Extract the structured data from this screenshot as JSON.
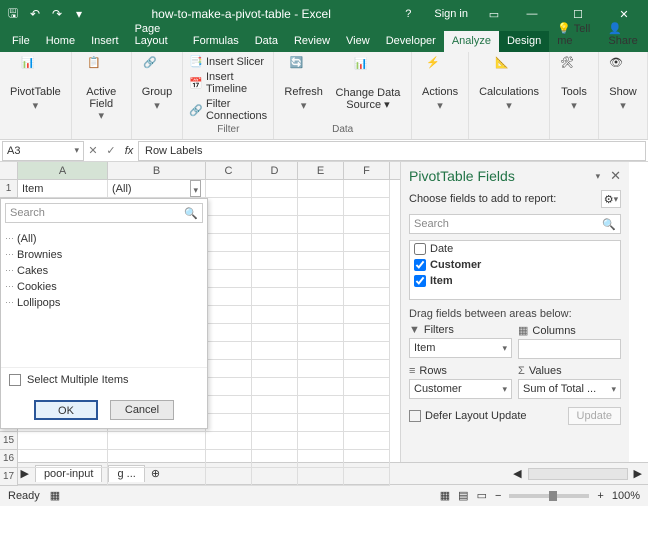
{
  "title": "how-to-make-a-pivot-table - Excel",
  "qat_icons": [
    "save-icon",
    "undo-icon",
    "redo-icon",
    "qat-more-icon"
  ],
  "signin": "Sign in",
  "tabs": [
    "File",
    "Home",
    "Insert",
    "Page Layout",
    "Formulas",
    "Data",
    "Review",
    "View",
    "Developer"
  ],
  "context_tabs": {
    "analyze": "Analyze",
    "design": "Design"
  },
  "tellme": "Tell me",
  "share": "Share",
  "ribbon": {
    "pivottable": "PivotTable",
    "activefield": "Active Field",
    "group": "Group",
    "insert_slicer": "Insert Slicer",
    "insert_timeline": "Insert Timeline",
    "filter_connections": "Filter Connections",
    "filter_group": "Filter",
    "refresh": "Refresh",
    "change_data": "Change Data Source",
    "data_group": "Data",
    "actions": "Actions",
    "calculations": "Calculations",
    "tools": "Tools",
    "show": "Show"
  },
  "namebox": "A3",
  "formula": "Row Labels",
  "columns": [
    "A",
    "B",
    "C",
    "D",
    "E",
    "F"
  ],
  "row1": {
    "a": "Item",
    "b": "(All)"
  },
  "filter_dropdown": {
    "search_placeholder": "Search",
    "items": [
      "(All)",
      "Brownies",
      "Cakes",
      "Cookies",
      "Lollipops"
    ],
    "select_multi": "Select Multiple Items",
    "ok": "OK",
    "cancel": "Cancel"
  },
  "visible_rows": [
    "15",
    "16",
    "17"
  ],
  "ptf": {
    "title": "PivotTable Fields",
    "subtitle": "Choose fields to add to report:",
    "search_placeholder": "Search",
    "fields": [
      {
        "label": "Date",
        "checked": false
      },
      {
        "label": "Customer",
        "checked": true
      },
      {
        "label": "Item",
        "checked": true
      }
    ],
    "drag_label": "Drag fields between areas below:",
    "areas": {
      "filters": {
        "label": "Filters",
        "value": "Item"
      },
      "columns": {
        "label": "Columns",
        "value": ""
      },
      "rows": {
        "label": "Rows",
        "value": "Customer"
      },
      "values": {
        "label": "Values",
        "value": "Sum of Total ..."
      }
    },
    "defer": "Defer Layout Update",
    "update": "Update"
  },
  "sheets": {
    "s1": "poor-input",
    "s2": "g ..."
  },
  "status": {
    "ready": "Ready",
    "zoom": "100%"
  }
}
